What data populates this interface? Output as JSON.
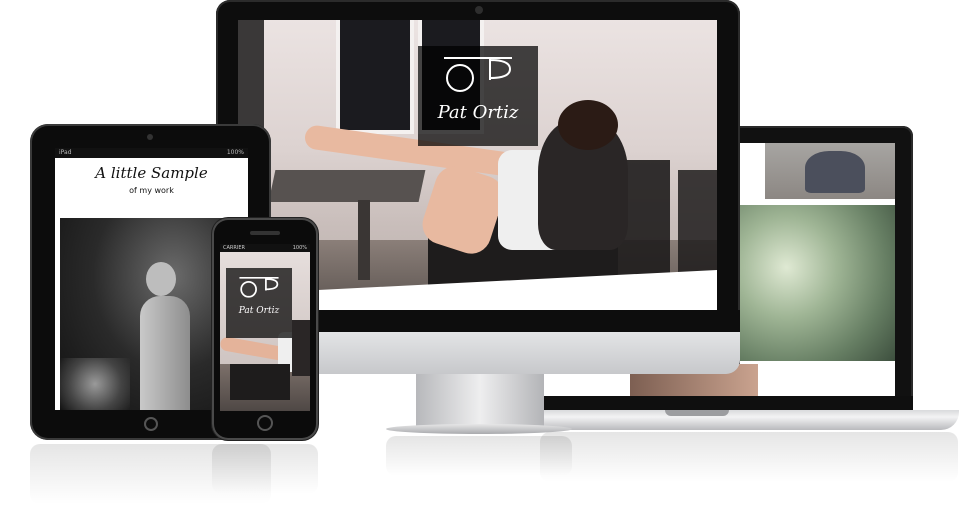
{
  "showcase": {
    "brand_name": "Pat Ortiz",
    "tablet": {
      "status_left": "iPad",
      "status_right": "100%",
      "heading": "A little Sample",
      "subheading": "of my work"
    },
    "phone": {
      "status_carrier": "CARRIER",
      "status_right": "100%"
    }
  },
  "colors": {
    "device_black": "#0d0d0d",
    "silver": "#d9dadc",
    "logo_box": "#000000"
  },
  "icons": [
    "logo-glasses-icon",
    "camera-icon",
    "home-button-icon"
  ]
}
